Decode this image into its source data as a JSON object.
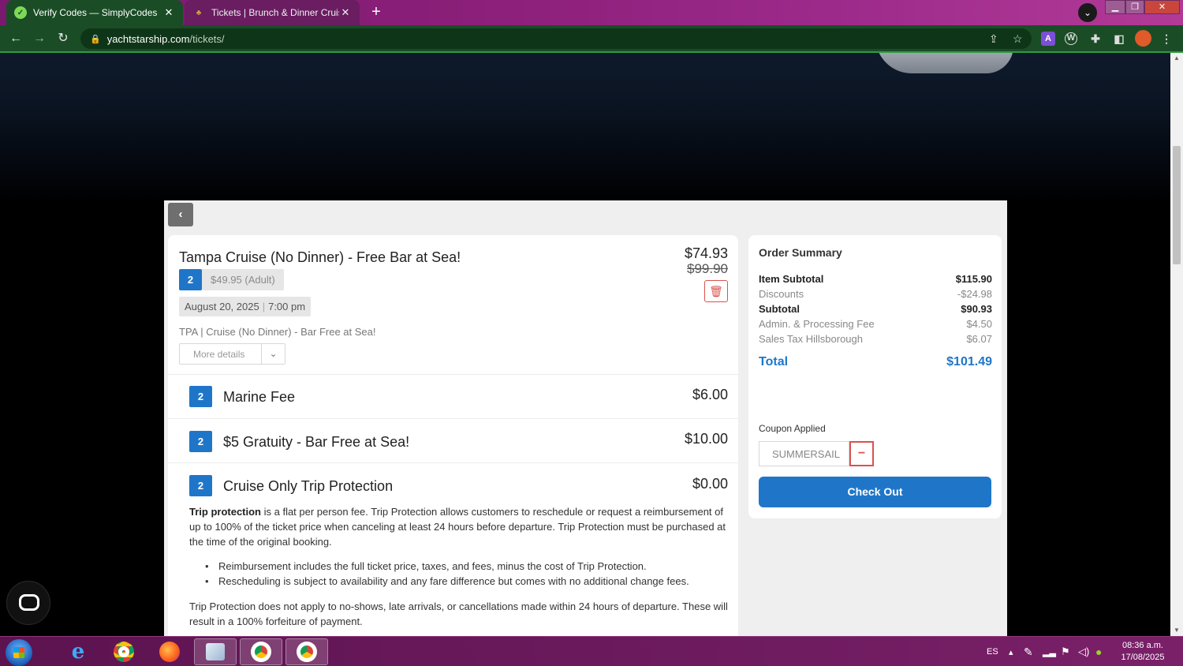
{
  "browser": {
    "tabs": [
      {
        "title": "Verify Codes — SimplyCodes",
        "favicon": "check-icon",
        "active": true
      },
      {
        "title": "Tickets | Brunch & Dinner Cruises",
        "favicon": "palm-icon",
        "active": false
      }
    ],
    "url_host": "yachtstarship.com",
    "url_path": "/tickets/",
    "colors": {
      "frame": "#1a4d26",
      "tabstrip": "#8b1f79"
    }
  },
  "product": {
    "title": "Tampa Cruise (No Dinner) - Free Bar at Sea!",
    "qty": "2",
    "unit_price": "$49.95 (Adult)",
    "date": "August 20, 2025",
    "time": "7:00 pm",
    "code_desc": "TPA | Cruise (No Dinner) - Bar Free at Sea!",
    "more_details": "More details",
    "price": "$74.93",
    "old_price": "$99.90"
  },
  "fees": [
    {
      "qty": "2",
      "name": "Marine Fee",
      "price": "$6.00"
    },
    {
      "qty": "2",
      "name": "$5 Gratuity - Bar Free at Sea!",
      "price": "$10.00"
    },
    {
      "qty": "2",
      "name": "Cruise Only Trip Protection",
      "price": "$0.00"
    }
  ],
  "trip_protection": {
    "lead": "Trip protection",
    "body": " is a flat per person fee. Trip Protection allows customers to reschedule or request a reimbursement of up to 100% of the ticket price when canceling at least 24 hours before departure. Trip Protection must be purchased at the time of the original booking.",
    "bullets": [
      "Reimbursement includes the full ticket price, taxes, and fees, minus the cost of Trip Protection.",
      "Rescheduling is subject to availability and any fare difference but comes with no additional change fees."
    ],
    "footer": "Trip Protection does not apply to no-shows, late arrivals, or cancellations made within 24 hours of departure. These will result in a 100% forfeiture of payment."
  },
  "summary": {
    "title": "Order Summary",
    "rows": [
      {
        "label": "Item Subtotal",
        "value": "$115.90"
      },
      {
        "label": "Discounts",
        "value": "-$24.98"
      },
      {
        "label": "Subtotal",
        "value": "$90.93"
      },
      {
        "label": "Admin. & Processing Fee",
        "value": "$4.50"
      },
      {
        "label": "Sales Tax Hillsborough",
        "value": "$6.07"
      }
    ],
    "total_label": "Total",
    "total_value": "$101.49",
    "coupon_label": "Coupon Applied",
    "coupon_code": "SUMMERSAIL",
    "checkout_label": "Check Out"
  },
  "taskbar": {
    "lang": "ES",
    "time": "08:36 a.m.",
    "date": "17/08/2025"
  }
}
